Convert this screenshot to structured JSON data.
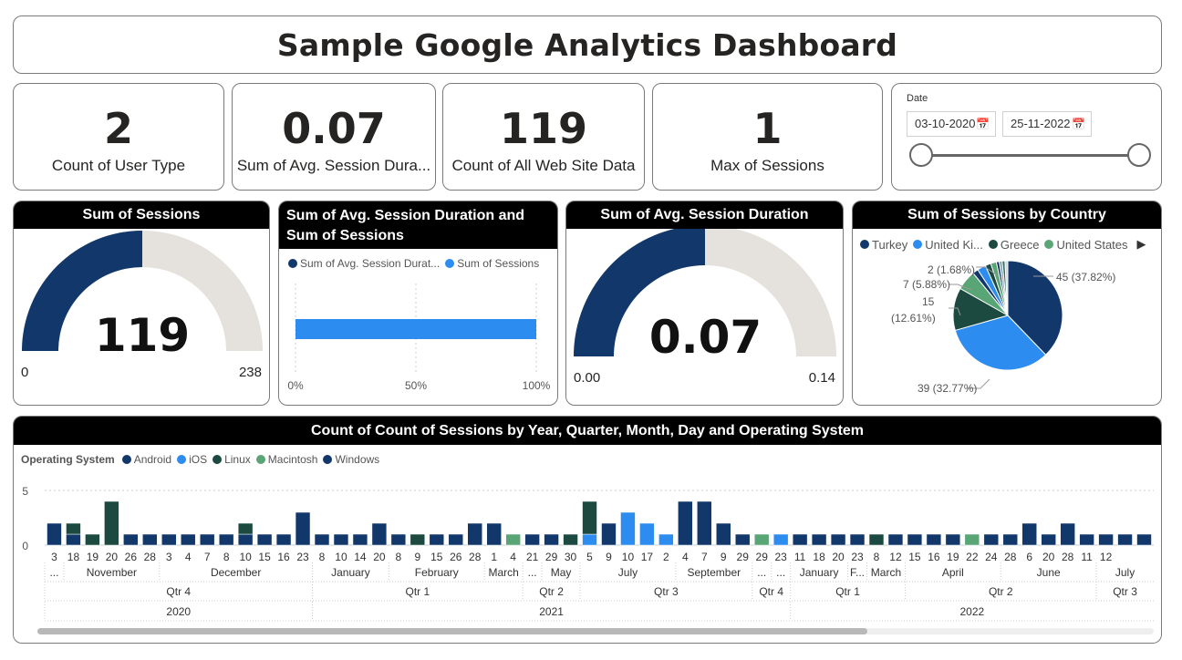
{
  "title": "Sample Google Analytics Dashboard",
  "kpis": [
    {
      "value": "2",
      "label": "Count of User Type"
    },
    {
      "value": "0.07",
      "label": "Sum of Avg. Session Dura..."
    },
    {
      "value": "119",
      "label": "Count of All Web Site Data"
    },
    {
      "value": "1",
      "label": "Max of Sessions"
    }
  ],
  "date_slicer": {
    "title": "Date",
    "start": "03-10-2020",
    "end": "25-11-2022",
    "calendar_icon": "calendar-icon"
  },
  "gauge_sessions": {
    "title": "Sum of Sessions",
    "value": "119",
    "min": "0",
    "max": "238",
    "fraction": 0.5,
    "fill_color": "#12386b",
    "rest_color": "#e5e1dc"
  },
  "bar_card": {
    "title": "Sum of Avg. Session Duration and Sum of Sessions",
    "legend": [
      {
        "label": "Sum of Avg. Session Durat...",
        "color": "#12386b"
      },
      {
        "label": "Sum of Sessions",
        "color": "#2d8cf0"
      }
    ],
    "ticks": [
      "0%",
      "50%",
      "100%"
    ],
    "bar_value_fraction": 1.0
  },
  "gauge_duration": {
    "title": "Sum of Avg. Session Duration",
    "value": "0.07",
    "min": "0.00",
    "max": "0.14",
    "fraction": 0.5
  },
  "pie": {
    "title": "Sum of Sessions by Country",
    "legend": [
      {
        "label": "Turkey",
        "color": "#12386b"
      },
      {
        "label": "United Ki...",
        "color": "#2d8cf0"
      },
      {
        "label": "Greece",
        "color": "#1c4a40"
      },
      {
        "label": "United States",
        "color": "#5aa575"
      }
    ],
    "more_icon": "chevron-right-icon",
    "labels": [
      "45 (37.82%)",
      "39 (32.77%)",
      "15",
      "(12.61%)",
      "7 (5.88%)",
      "2 (1.68%)"
    ]
  },
  "chart_data": {
    "type": "bar",
    "title": "Count of Count of Sessions by Year, Quarter, Month, Day and Operating System",
    "legend_title": "Operating System",
    "series": [
      {
        "name": "Android",
        "color": "#12386b"
      },
      {
        "name": "iOS",
        "color": "#2d8cf0"
      },
      {
        "name": "Linux",
        "color": "#1c4a40"
      },
      {
        "name": "Macintosh",
        "color": "#5aa575"
      },
      {
        "name": "Windows",
        "color": "#12386b"
      }
    ],
    "yticks": [
      "5",
      "0"
    ],
    "ylim": [
      0,
      5
    ],
    "days": [
      "3",
      "18",
      "19",
      "20",
      "26",
      "28",
      "3",
      "4",
      "7",
      "8",
      "10",
      "15",
      "16",
      "23",
      "8",
      "10",
      "14",
      "20",
      "8",
      "9",
      "15",
      "26",
      "28",
      "1",
      "4",
      "21",
      "29",
      "30",
      "5",
      "9",
      "10",
      "17",
      "2",
      "4",
      "7",
      "9",
      "29",
      "29",
      "23",
      "11",
      "18",
      "20",
      "23",
      "8",
      "12",
      "15",
      "16",
      "19",
      "22",
      "24",
      "28",
      "6",
      "20",
      "28",
      "11",
      "12"
    ],
    "bars": [
      {
        "android": 2
      },
      {
        "android": 1,
        "linux": 1
      },
      {
        "linux": 1
      },
      {
        "linux": 4
      },
      {
        "android": 1
      },
      {
        "android": 1
      },
      {
        "android": 1
      },
      {
        "android": 1
      },
      {
        "android": 1
      },
      {
        "android": 1
      },
      {
        "android": 1,
        "linux": 1
      },
      {
        "android": 1
      },
      {
        "android": 1
      },
      {
        "android": 3
      },
      {
        "android": 1
      },
      {
        "android": 1
      },
      {
        "android": 1
      },
      {
        "android": 2
      },
      {
        "android": 1
      },
      {
        "linux": 1
      },
      {
        "android": 1
      },
      {
        "android": 1
      },
      {
        "android": 2
      },
      {
        "android": 2
      },
      {
        "macintosh": 1
      },
      {
        "android": 1
      },
      {
        "android": 1
      },
      {
        "linux": 1
      },
      {
        "ios": 1,
        "linux": 3
      },
      {
        "android": 2
      },
      {
        "ios": 3
      },
      {
        "ios": 2
      },
      {
        "ios": 1
      },
      {
        "android": 4
      },
      {
        "android": 4
      },
      {
        "android": 2
      },
      {
        "android": 1
      },
      {
        "macintosh": 1
      },
      {
        "ios": 1
      },
      {
        "android": 1
      },
      {
        "android": 1
      },
      {
        "android": 1
      },
      {
        "android": 1
      },
      {
        "linux": 1
      },
      {
        "android": 1
      },
      {
        "android": 1
      },
      {
        "android": 1
      },
      {
        "android": 1
      },
      {
        "macintosh": 1
      },
      {
        "android": 1
      },
      {
        "android": 1
      },
      {
        "android": 2
      },
      {
        "android": 1
      },
      {
        "android": 2
      },
      {
        "android": 1
      },
      {
        "android": 1
      },
      {
        "android": 1
      },
      {
        "android": 1
      }
    ],
    "month_labels": [
      {
        "label": "...",
        "start": 0,
        "end": 1
      },
      {
        "label": "November",
        "start": 1,
        "end": 6
      },
      {
        "label": "December",
        "start": 6,
        "end": 14
      },
      {
        "label": "January",
        "start": 14,
        "end": 18
      },
      {
        "label": "February",
        "start": 18,
        "end": 23
      },
      {
        "label": "March",
        "start": 23,
        "end": 25
      },
      {
        "label": "...",
        "start": 25,
        "end": 26
      },
      {
        "label": "May",
        "start": 26,
        "end": 28
      },
      {
        "label": "July",
        "start": 28,
        "end": 33
      },
      {
        "label": "September",
        "start": 33,
        "end": 37
      },
      {
        "label": "...",
        "start": 37,
        "end": 38
      },
      {
        "label": "...",
        "start": 38,
        "end": 39
      },
      {
        "label": "January",
        "start": 39,
        "end": 42
      },
      {
        "label": "F...",
        "start": 42,
        "end": 43
      },
      {
        "label": "March",
        "start": 43,
        "end": 45
      },
      {
        "label": "April",
        "start": 45,
        "end": 50
      },
      {
        "label": "June",
        "start": 50,
        "end": 55
      },
      {
        "label": "July",
        "start": 55,
        "end": 58
      }
    ],
    "quarter_labels": [
      {
        "label": "Qtr 4",
        "start": 0,
        "end": 14
      },
      {
        "label": "Qtr 1",
        "start": 14,
        "end": 25
      },
      {
        "label": "Qtr 2",
        "start": 25,
        "end": 28
      },
      {
        "label": "Qtr 3",
        "start": 28,
        "end": 37
      },
      {
        "label": "Qtr 4",
        "start": 37,
        "end": 39
      },
      {
        "label": "Qtr 1",
        "start": 39,
        "end": 45
      },
      {
        "label": "Qtr 2",
        "start": 45,
        "end": 55
      },
      {
        "label": "Qtr 3",
        "start": 55,
        "end": 58
      }
    ],
    "year_labels": [
      {
        "label": "2020",
        "start": 0,
        "end": 14
      },
      {
        "label": "2021",
        "start": 14,
        "end": 39
      },
      {
        "label": "2022",
        "start": 39,
        "end": 58
      }
    ]
  }
}
